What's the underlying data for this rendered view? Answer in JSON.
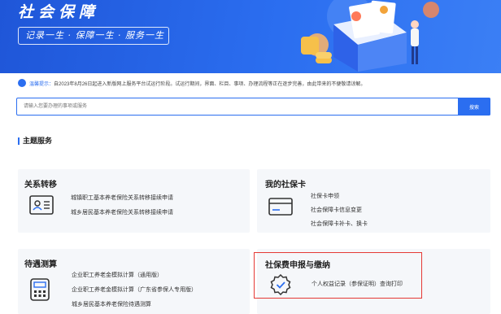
{
  "banner": {
    "title": "社会保障",
    "slogan": "记录一生 · 保障一生 · 服务一生"
  },
  "notice": {
    "icon": "bullhorn-icon",
    "label": "温馨提示：",
    "text": "自2023年8月26日起进入新版网上服务平台试运行阶段。试运行期间，界面、栏目、事项、办理流程等正在逐步完善，由此带来的不便敬请谅解。"
  },
  "search": {
    "placeholder": "请输入您要办理的事项或服务",
    "button_label": "搜索"
  },
  "section": {
    "title": "主题服务"
  },
  "cards": [
    {
      "title": "关系转移",
      "icon": "id-card-icon",
      "items": [
        "城镇职工基本养老保险关系转移接续申请",
        "城乡居民基本养老保险关系转移接续申请"
      ]
    },
    {
      "title": "我的社保卡",
      "icon": "bank-card-icon",
      "items": [
        "社保卡申领",
        "社会保障卡信息变更",
        "社会保障卡补卡、换卡"
      ]
    },
    {
      "title": "待遇测算",
      "icon": "calculator-icon",
      "items": [
        "企业职工养老金模拟计算（通用版）",
        "企业职工养老金模拟计算（广东省参保人专用版）",
        "城乡居民基本养老保险待遇测算"
      ]
    },
    {
      "title": "社保费申报与缴纳",
      "icon": "verified-badge-icon",
      "items": [
        "个人权益记录（参保证明）查询打印"
      ]
    }
  ],
  "colors": {
    "primary": "#2b6ef0",
    "highlight": "#e53935",
    "card_bg": "#f5f7fa"
  }
}
